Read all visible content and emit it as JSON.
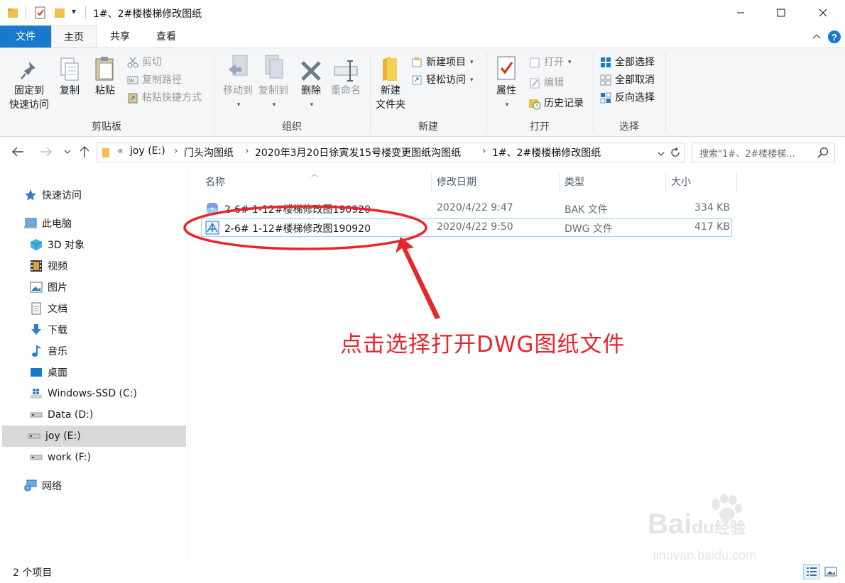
{
  "window": {
    "title": "1#、2#楼楼梯修改图纸",
    "quick_access_dropdown": "▾",
    "minimize": "—",
    "maximize": "☐",
    "close": "✕"
  },
  "ribbon_tabs": [
    {
      "label": "文件"
    },
    {
      "label": "主页"
    },
    {
      "label": "共享"
    },
    {
      "label": "查看"
    }
  ],
  "ribbon": {
    "clipboard": {
      "group_label": "剪贴板",
      "pin_line1": "固定到",
      "pin_line2": "快速访问",
      "copy": "复制",
      "paste": "粘贴",
      "cut": "剪切",
      "copy_path": "复制路径",
      "paste_shortcut": "粘贴快捷方式"
    },
    "organize": {
      "group_label": "组织",
      "move_to": "移动到",
      "copy_to": "复制到",
      "delete": "删除",
      "rename": "重命名"
    },
    "new": {
      "group_label": "新建",
      "new_folder_line1": "新建",
      "new_folder_line2": "文件夹",
      "new_item": "新建项目",
      "easy_access": "轻松访问"
    },
    "open": {
      "group_label": "打开",
      "properties": "属性",
      "open": "打开",
      "edit": "编辑",
      "history": "历史记录"
    },
    "select": {
      "group_label": "选择",
      "select_all": "全部选择",
      "select_none": "全部取消",
      "invert": "反向选择"
    }
  },
  "address": {
    "overflow": "«",
    "crumbs": [
      "joy (E:)",
      "门头沟图纸",
      "2020年3月20日徐寅发15号楼变更图纸沟图纸",
      "1#、2#楼楼梯修改图纸"
    ],
    "search_placeholder": "搜索\"1#、2#楼楼梯..."
  },
  "nav": [
    {
      "label": "快速访问",
      "icon": "star-icon"
    },
    {
      "label": "此电脑",
      "icon": "computer-icon"
    },
    {
      "label": "3D 对象",
      "icon": "cube-icon"
    },
    {
      "label": "视频",
      "icon": "film-icon"
    },
    {
      "label": "图片",
      "icon": "picture-icon"
    },
    {
      "label": "文档",
      "icon": "document-icon"
    },
    {
      "label": "下载",
      "icon": "download-icon"
    },
    {
      "label": "音乐",
      "icon": "music-icon"
    },
    {
      "label": "桌面",
      "icon": "desktop-icon"
    },
    {
      "label": "Windows-SSD (C:)",
      "icon": "windows-drive-icon"
    },
    {
      "label": "Data (D:)",
      "icon": "drive-icon"
    },
    {
      "label": "joy (E:)",
      "icon": "drive-icon",
      "selected": true
    },
    {
      "label": "work (F:)",
      "icon": "drive-icon"
    },
    {
      "label": "网络",
      "icon": "network-icon"
    }
  ],
  "columns": {
    "name": "名称",
    "modified": "修改日期",
    "type": "类型",
    "size": "大小"
  },
  "files": [
    {
      "name": "2-6# 1-12#楼梯修改图190920",
      "modified": "2020/4/22 9:47",
      "type": "BAK 文件",
      "size": "334 KB",
      "icon": "bak-file-icon"
    },
    {
      "name": "2-6# 1-12#楼梯修改图190920",
      "modified": "2020/4/22 9:50",
      "type": "DWG 文件",
      "size": "417 KB",
      "icon": "dwg-file-icon",
      "selected": true
    }
  ],
  "annotation": {
    "text": "点击选择打开DWG图纸文件",
    "color": "#e8262a"
  },
  "status": {
    "item_count": "2 个项目"
  },
  "watermark": {
    "brand": "Bai",
    "brand_suffix": "经验",
    "site": "jingyan.baidu.com"
  },
  "colors": {
    "accent": "#1979ca",
    "selection_border": "#99d1ff",
    "annotation": "#e8262a"
  }
}
